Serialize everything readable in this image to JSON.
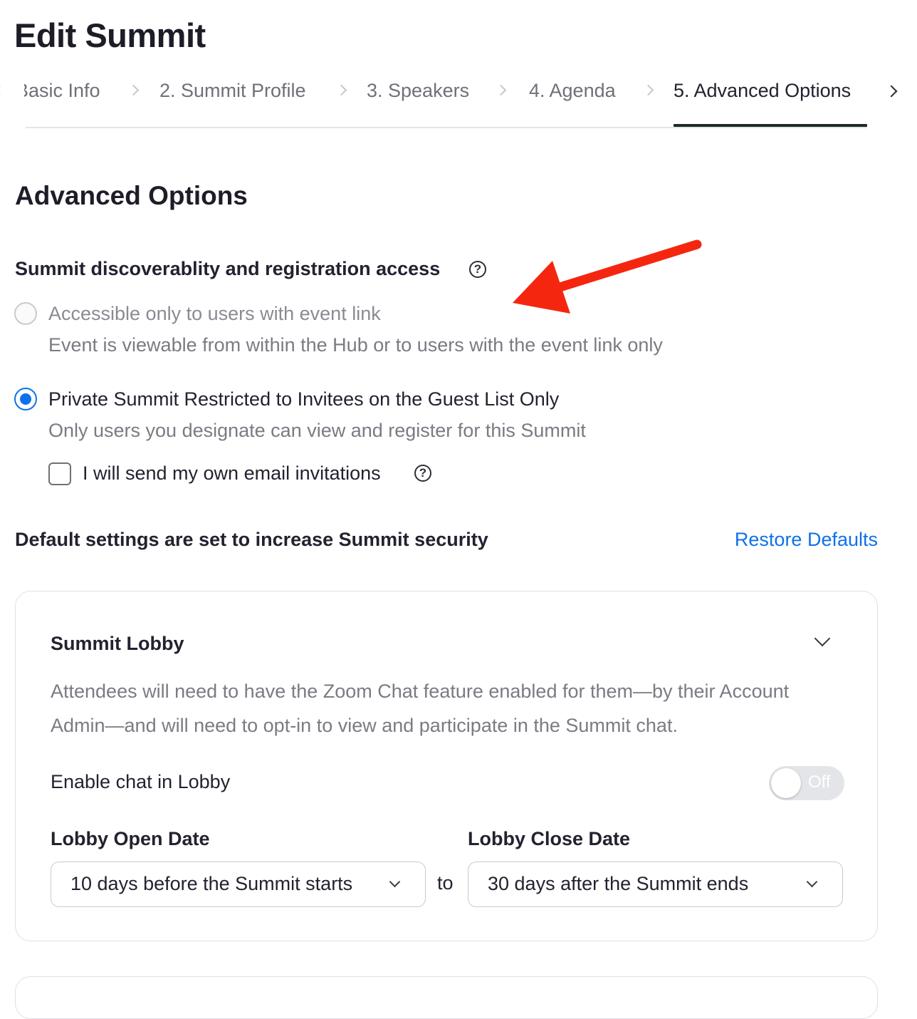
{
  "page": {
    "title": "Edit Summit"
  },
  "stepper": {
    "steps": [
      {
        "label": "Basic Info",
        "visible_text": "Basic Info"
      },
      {
        "label": "2. Summit Profile"
      },
      {
        "label": "3. Speakers"
      },
      {
        "label": "4. Agenda"
      },
      {
        "label": "5. Advanced Options",
        "active": true
      }
    ]
  },
  "section": {
    "title": "Advanced Options"
  },
  "discoverability": {
    "label": "Summit discoverablity and registration access",
    "options": [
      {
        "label": "Accessible only to users with event link",
        "description": "Event is viewable from within the Hub or to users with the event link only",
        "selected": false
      },
      {
        "label": "Private Summit Restricted to Invitees on the Guest List Only",
        "description": "Only users you designate can view and register for this Summit",
        "selected": true
      }
    ],
    "own_invitations": {
      "label": "I will send my own email invitations",
      "checked": false
    }
  },
  "defaults": {
    "label": "Default settings are set to increase Summit security",
    "restore_link": "Restore Defaults"
  },
  "lobby_card": {
    "title": "Summit Lobby",
    "description": "Attendees will need to have the Zoom Chat feature enabled for them—by their Account Admin—and will need to opt-in to view and participate in the Summit chat.",
    "chat_toggle": {
      "label": "Enable chat in Lobby",
      "state_text": "Off",
      "on": false
    },
    "open_date": {
      "label": "Lobby Open Date",
      "value": "10 days before the Summit starts"
    },
    "to_label": "to",
    "close_date": {
      "label": "Lobby Close Date",
      "value": "30 days after the Summit ends"
    }
  },
  "colors": {
    "accent": "#0e71eb",
    "annotation_arrow": "#f5260f",
    "muted_text": "#7a7b83"
  },
  "icons": [
    "chevron-left-icon",
    "chevron-right-icon",
    "help-icon",
    "chevron-down-icon",
    "red-arrow-annotation"
  ]
}
